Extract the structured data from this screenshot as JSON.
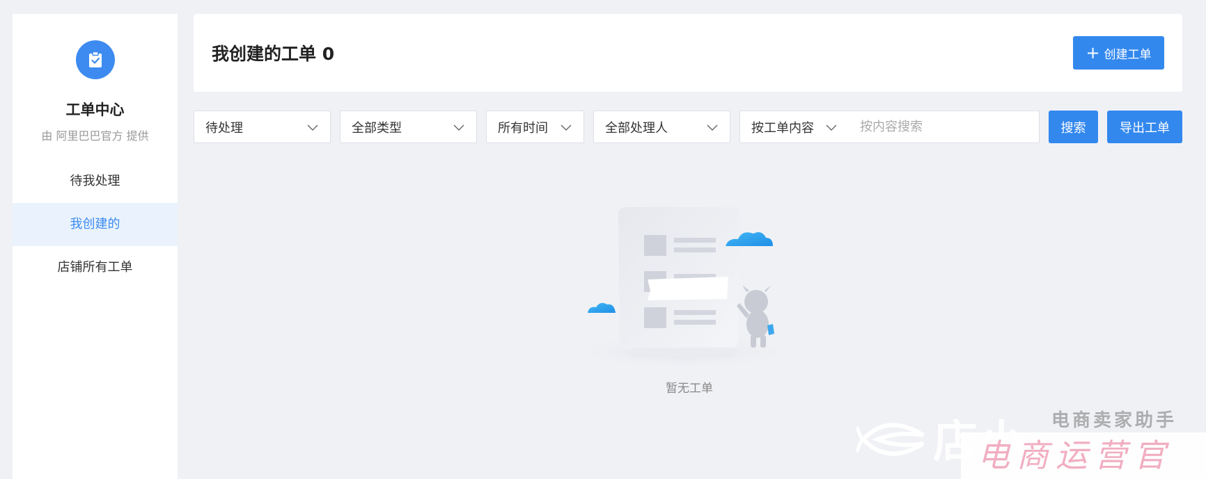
{
  "sidebar": {
    "logo_icon": "clipboard-check-icon",
    "title": "工单中心",
    "provider": "由 阿里巴巴官方 提供",
    "items": [
      {
        "label": "待我处理"
      },
      {
        "label": "我创建的",
        "active": true
      },
      {
        "label": "店铺所有工单"
      }
    ]
  },
  "header": {
    "title": "我创建的工单 0",
    "create_button": "创建工单",
    "create_icon": "plus-icon"
  },
  "filters": {
    "status": "待处理",
    "type": "全部类型",
    "time": "所有时间",
    "handler": "全部处理人",
    "search_field": "按工单内容",
    "search_placeholder": "按内容搜索",
    "search_button": "搜索",
    "export_button": "导出工单"
  },
  "empty_state": {
    "text": "暂无工单"
  },
  "watermark": {
    "top": "电商卖家助手",
    "brand": "店小",
    "bottom": "电商运营官"
  },
  "colors": {
    "primary": "#3388ee",
    "active_bg": "#eaf3fd",
    "page_bg": "#f0f1f5"
  }
}
